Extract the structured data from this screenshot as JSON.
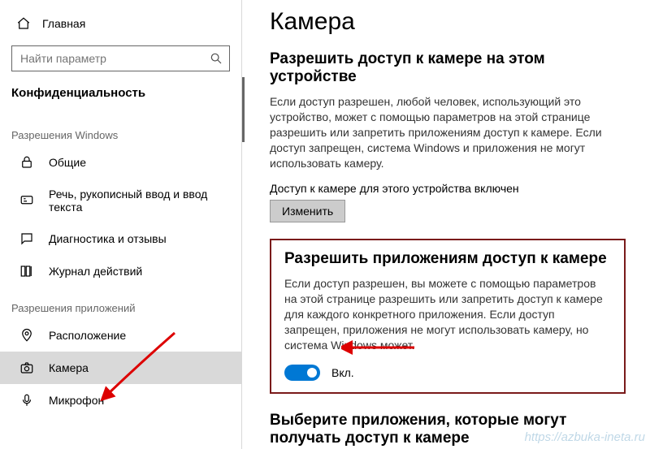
{
  "sidebar": {
    "home_label": "Главная",
    "search_placeholder": "Найти параметр",
    "current_section": "Конфиденциальность",
    "group1_title": "Разрешения Windows",
    "group1_items": [
      {
        "label": "Общие"
      },
      {
        "label": "Речь, рукописный ввод и ввод текста"
      },
      {
        "label": "Диагностика и отзывы"
      },
      {
        "label": "Журнал действий"
      }
    ],
    "group2_title": "Разрешения приложений",
    "group2_items": [
      {
        "label": "Расположение"
      },
      {
        "label": "Камера"
      },
      {
        "label": "Микрофон"
      }
    ]
  },
  "content": {
    "page_title": "Камера",
    "section1": {
      "heading": "Разрешить доступ к камере на этом устройстве",
      "body": "Если доступ разрешен, любой человек, использующий это устройство, может с помощью параметров на этой странице разрешить или запретить приложениям доступ к камере. Если доступ запрещен, система Windows и приложения не могут использовать камеру.",
      "status": "Доступ к камере для этого устройства включен",
      "button": "Изменить"
    },
    "section2": {
      "heading": "Разрешить приложениям доступ к камере",
      "body": "Если доступ разрешен, вы можете с помощью параметров на этой странице разрешить или запретить доступ к камере для каждого конкретного приложения. Если доступ запрещен, приложения не могут использовать камеру, но система Windows может.",
      "toggle_label": "Вкл."
    },
    "section3": {
      "heading": "Выберите приложения, которые могут получать доступ к камере"
    }
  },
  "watermark": "https://azbuka-ineta.ru"
}
